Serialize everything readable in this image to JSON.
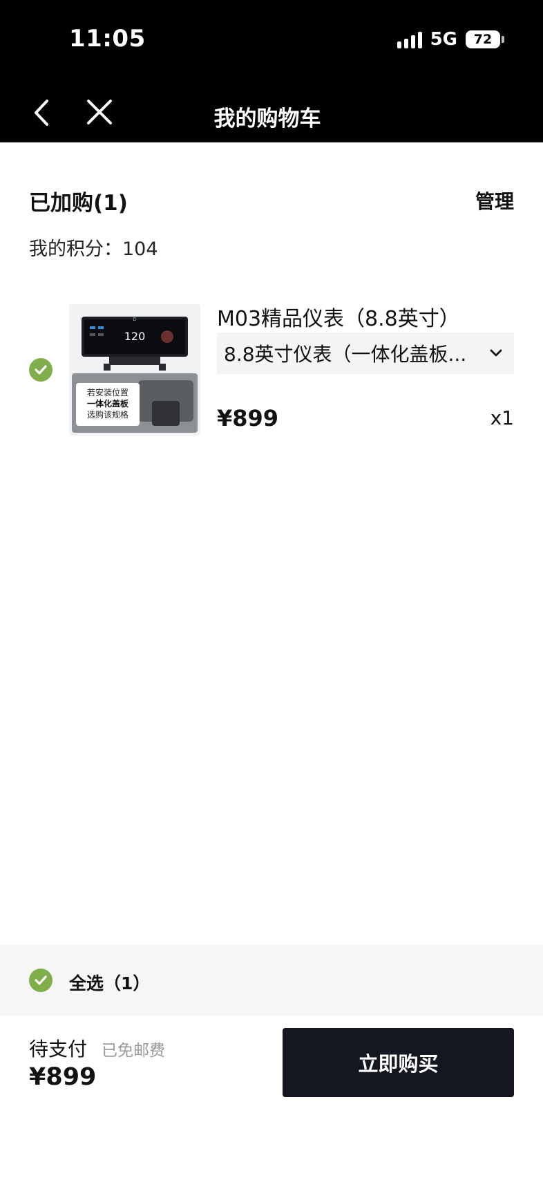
{
  "status_bar": {
    "time": "11:05",
    "network": "5G",
    "battery": "72"
  },
  "nav": {
    "title": "我的购物车",
    "back_icon": "chevron-left-icon",
    "close_icon": "close-icon"
  },
  "cart": {
    "header": "已加购(1)",
    "manage_label": "管理",
    "points_label": "我的积分：",
    "points_value": "104"
  },
  "item": {
    "name": "M03精品仪表（8.8英寸）",
    "spec": "8.8英寸仪表（一体化盖板...",
    "price": "¥899",
    "quantity": "x1",
    "thumb": {
      "screen_speed": "120",
      "screen_gear": "D",
      "caption_line1": "若安装位置",
      "caption_line2": "一体化盖板",
      "caption_line3": "选购该规格"
    }
  },
  "select_all": {
    "label": "全选（1）"
  },
  "checkout": {
    "pending_label": "待支付",
    "shipping_note": "已免邮费",
    "total": "¥899",
    "buy_label": "立即购买"
  },
  "colors": {
    "accent_check": "#7fae4b",
    "button_dark": "#141720",
    "topbar": "#000000"
  }
}
